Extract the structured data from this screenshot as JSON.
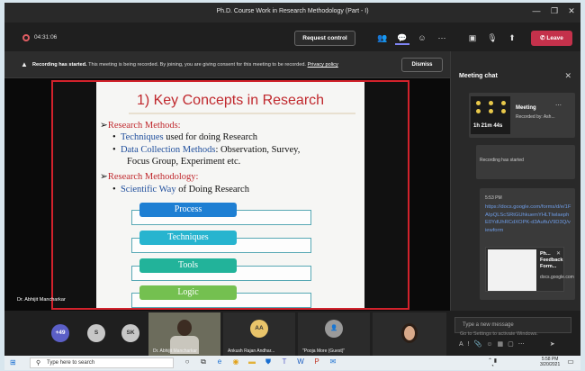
{
  "window": {
    "title": "Ph.D. Course Work in Research Methodology (Part - I)"
  },
  "toolbar": {
    "timer": "04:31:06",
    "request_control": "Request control",
    "leave": "Leave"
  },
  "banner": {
    "title": "Recording has started.",
    "message": "This meeting is being recorded. By joining, you are giving consent for this meeting to be recorded.",
    "privacy": "Privacy policy",
    "dismiss": "Dismiss"
  },
  "slide": {
    "title": "1) Key Concepts in Research",
    "h1": "Research Methods:",
    "b1_link": "Techniques",
    "b1_rest": "used for doing Research",
    "b2_link": "Data Collection Methods",
    "b2_rest": ": Observation, Survey,",
    "b2_cont": "Focus Group, Experiment etc.",
    "h2": "Research Methodology:",
    "b3_link": "Scientific Way",
    "b3_rest": "of Doing Research",
    "boxes": [
      "Process",
      "Techniques",
      "Tools",
      "Logic"
    ]
  },
  "presenter_label": "Dr. Abhijit Mancharkar",
  "chat": {
    "title": "Meeting chat",
    "meeting_duration": "1h 21m 44s",
    "meeting_label": "Meeting",
    "recorded_by": "Recorded by: Ash...",
    "recording_started": "Recording has started",
    "time": "5:53 PM",
    "link": "https://docs.google.com/forms/d/e/1FAIpQLScSRtGUhkuemYHLTIwlaephE0YdUhRCdXOPK-d3AuftuV9D3Q/viewform",
    "preview_title": "Ph... Feedback Form...",
    "preview_site": "docs.google.com",
    "compose_placeholder": "Type a new message",
    "watermark": "Go to Settings to activate Windows."
  },
  "participants": {
    "overflow": "+49",
    "s": "S",
    "sk": "SK",
    "aa": "AA",
    "tile1": "Dr. Abhijit Mancharkar",
    "tile2": "Ankush Rajan Andhar...",
    "tile3": "\"Pooja More (Guest)\""
  },
  "taskbar": {
    "search": "Type here to search",
    "time": "5:58 PM",
    "date": "3/20/2021"
  },
  "colors": {
    "leave": "#c4314b",
    "accent": "#6264a7",
    "share_border": "#d2222c",
    "box_colors": [
      "#1e7fd3",
      "#27b4cf",
      "#22b39a",
      "#74c050"
    ]
  }
}
